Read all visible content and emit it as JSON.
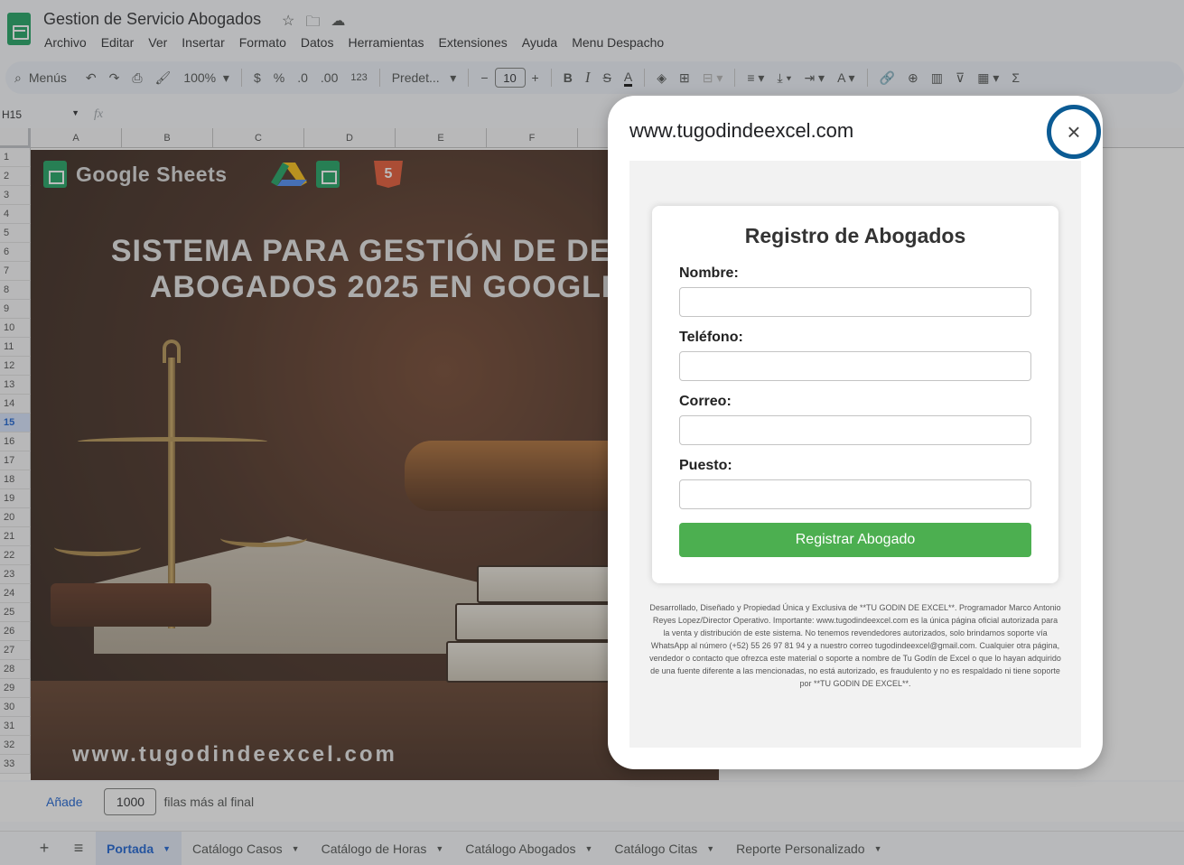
{
  "app": {
    "doc_title": "Gestion de Servicio Abogados",
    "menu": [
      "Archivo",
      "Editar",
      "Ver",
      "Insertar",
      "Formato",
      "Datos",
      "Herramientas",
      "Extensiones",
      "Ayuda",
      "Menu Despacho"
    ]
  },
  "toolbar": {
    "search_label": "Menús",
    "zoom": "100%",
    "currency": "$",
    "percent": "%",
    "decrease_decimals": ".0",
    "increase_decimals": ".00",
    "number_format": "123",
    "font": "Predet...",
    "font_size": "10",
    "bold": "B",
    "italic": "I",
    "strike": "S",
    "text_color": "A"
  },
  "formula_bar": {
    "cell_ref": "H15",
    "fx": "fx"
  },
  "grid": {
    "columns": [
      "A",
      "B",
      "C",
      "D",
      "E",
      "F"
    ],
    "rows": [
      "1",
      "2",
      "3",
      "4",
      "5",
      "6",
      "7",
      "8",
      "9",
      "10",
      "11",
      "12",
      "13",
      "14",
      "15",
      "16",
      "17",
      "18",
      "19",
      "20",
      "21",
      "22",
      "23",
      "24",
      "25",
      "26",
      "27",
      "28",
      "29",
      "30",
      "31",
      "32",
      "33"
    ],
    "active_row": "15"
  },
  "banner": {
    "logo_text": "Google Sheets",
    "html5_label": "5",
    "title_line1": "SISTEMA PARA GESTIÓN DE DESPACHO DE",
    "title_line2": "ABOGADOS 2025 EN GOOGLE SHEETS",
    "url": "www.tugodindeexcel.com"
  },
  "add_rows": {
    "link": "Añade",
    "count": "1000",
    "suffix": "filas más al final"
  },
  "sheet_tabs": {
    "add": "+",
    "list": "≡",
    "tabs": [
      "Portada",
      "Catálogo Casos",
      "Catálogo de Horas",
      "Catálogo Abogados",
      "Catálogo Citas",
      "Reporte Personalizado"
    ],
    "active": "Portada"
  },
  "dialog": {
    "title": "www.tugodindeexcel.com",
    "close": "×",
    "form_title": "Registro de Abogados",
    "fields": [
      {
        "label": "Nombre:",
        "value": ""
      },
      {
        "label": "Teléfono:",
        "value": ""
      },
      {
        "label": "Correo:",
        "value": ""
      },
      {
        "label": "Puesto:",
        "value": ""
      }
    ],
    "submit": "Registrar Abogado",
    "disclaimer": "Desarrollado, Diseñado y Propiedad Única y Exclusiva de **TU GODIN DE EXCEL**. Programador Marco Antonio Reyes Lopez/Director Operativo. Importante: www.tugodindeexcel.com es la única página oficial autorizada para la venta y distribución de este sistema. No tenemos revendedores autorizados, solo brindamos soporte vía WhatsApp al número (+52) 55 26 97 81 94 y a nuestro correo tugodindeexcel@gmail.com. Cualquier otra página, vendedor o contacto que ofrezca este material o soporte a nombre de Tu Godín de Excel o que lo hayan adquirido de una fuente diferente a las mencionadas, no está autorizado, es fraudulento y no es respaldado ni tiene soporte por **TU GODIN DE EXCEL**."
  },
  "colors": {
    "accent": "#0b57d0",
    "submit": "#4caf50",
    "close_ring": "#0b5b94",
    "sheets_green": "#0f9d58"
  }
}
